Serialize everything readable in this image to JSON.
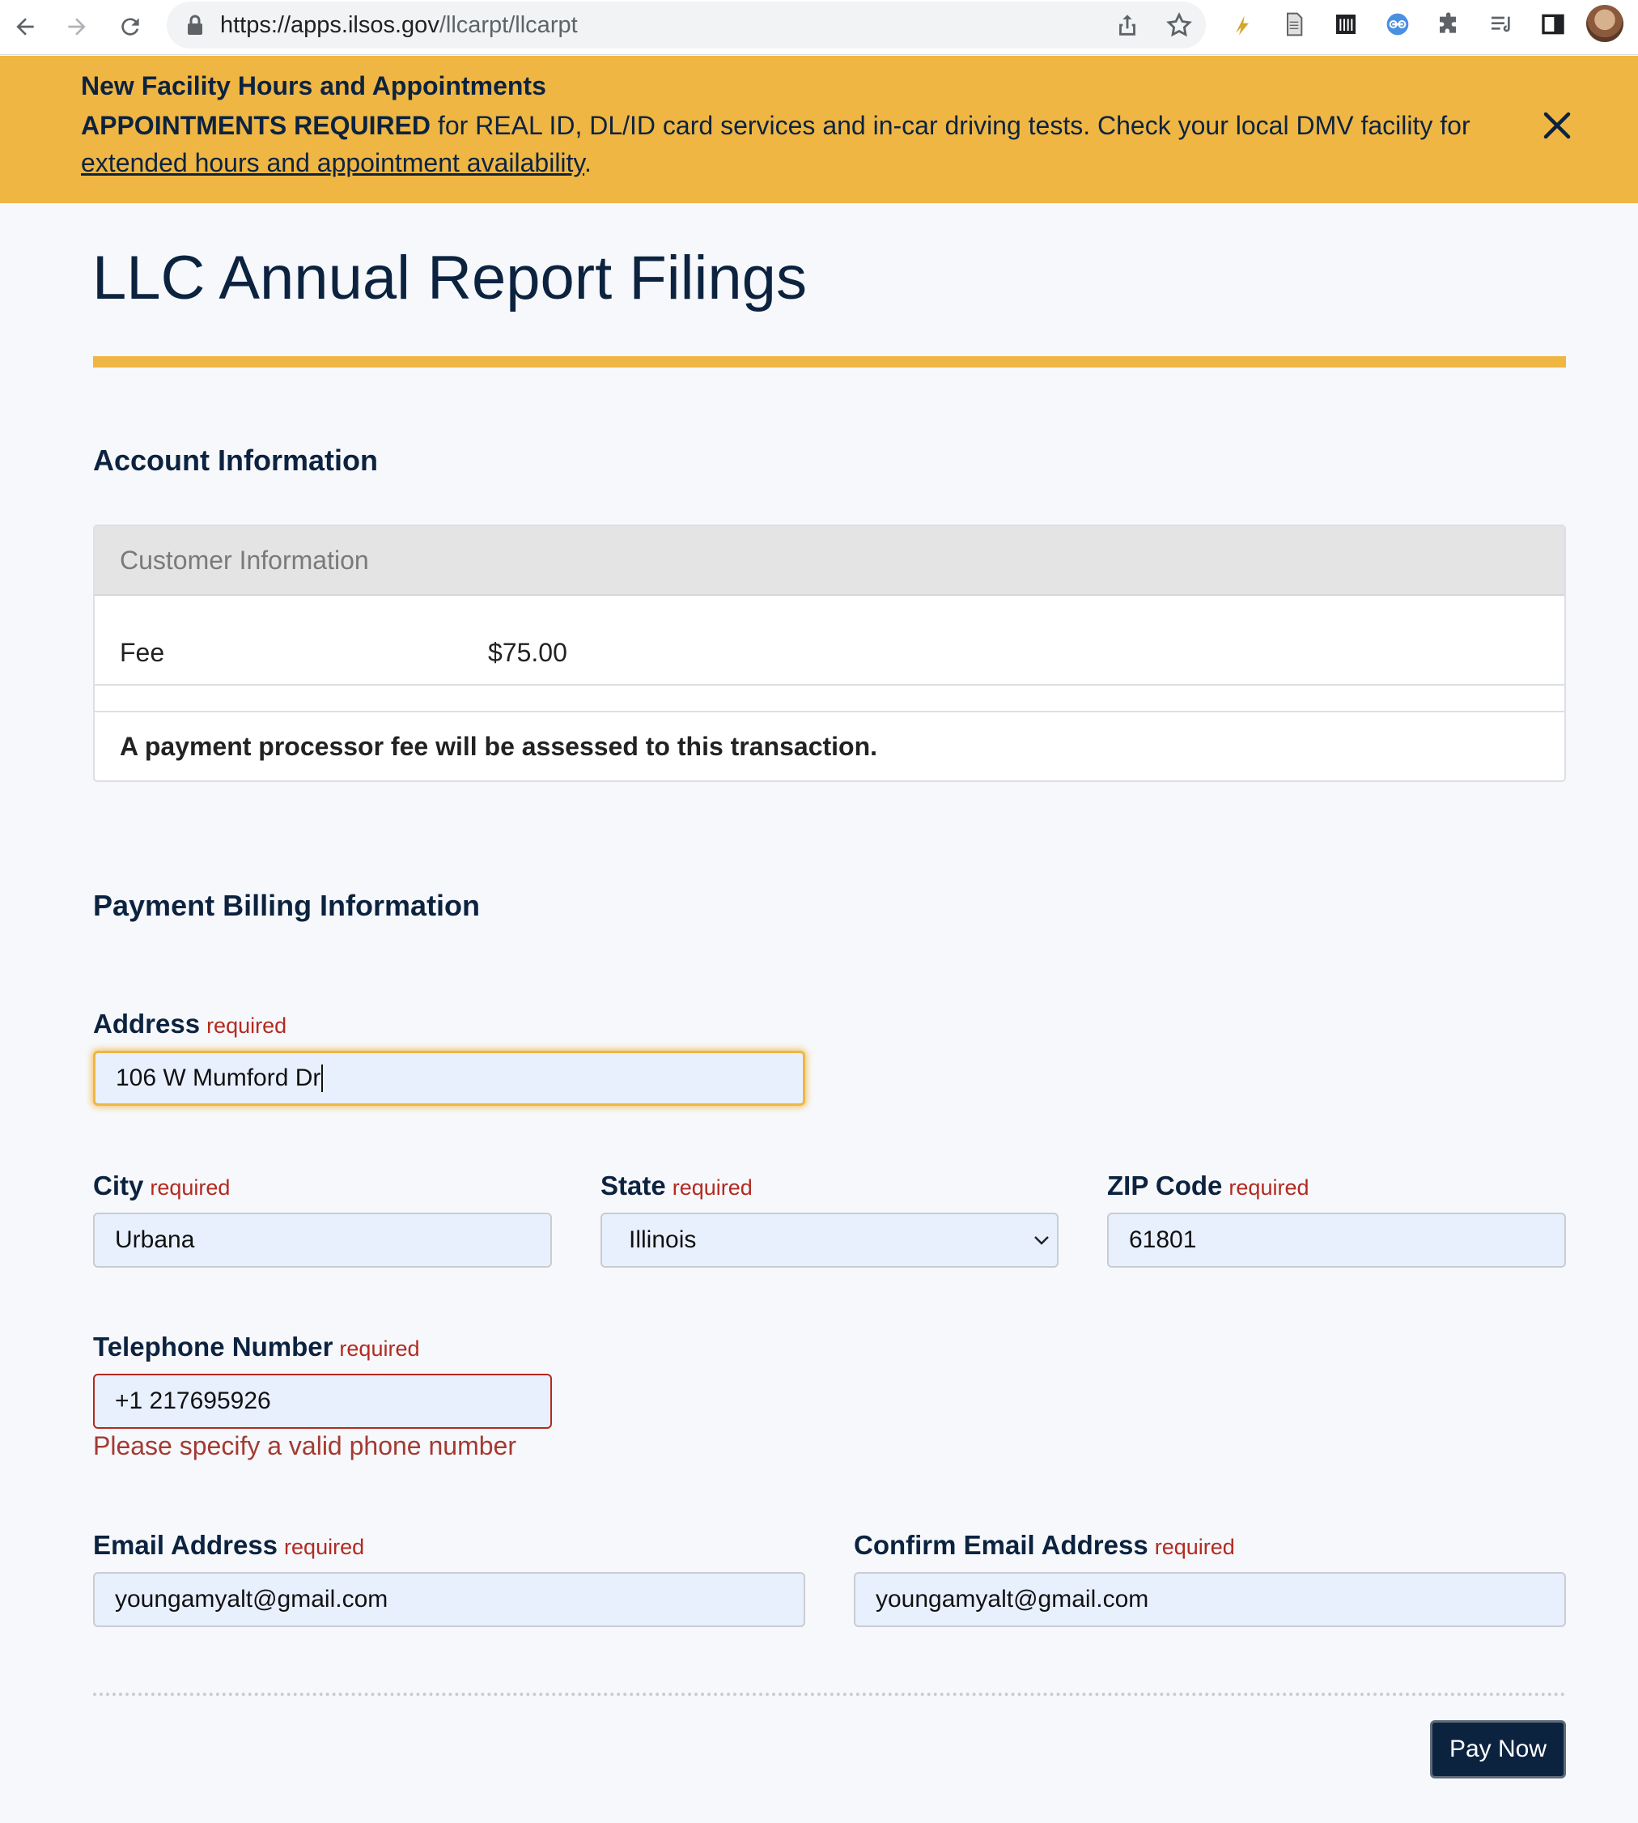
{
  "browser": {
    "url_host": "https://apps.ilsos.gov",
    "url_path": "/llcarpt/llcarpt",
    "icons": [
      "back-arrow-icon",
      "forward-arrow-icon",
      "reload-icon",
      "lock-icon",
      "share-icon",
      "star-icon",
      "extension-icons",
      "puzzle-icon",
      "reading-list-icon",
      "side-panel-icon",
      "profile-avatar"
    ]
  },
  "banner": {
    "title": "New Facility Hours and Appointments",
    "bold_text": "APPOINTMENTS REQUIRED",
    "text": " for REAL ID, DL/ID card services and in-car driving tests. Check your local DMV facility for ",
    "link_text": "extended hours and appointment availability",
    "end_text": ".",
    "background": "#efb643"
  },
  "page": {
    "title": "LLC Annual Report Filings"
  },
  "account": {
    "heading": "Account Information",
    "card_header": "Customer Information",
    "fee_label": "Fee",
    "fee_value": "$75.00",
    "note": "A payment processor fee will be assessed to this transaction."
  },
  "billing": {
    "heading": "Payment Billing Information",
    "required_text": "required",
    "address_label": "Address",
    "address_value": "106 W Mumford Dr",
    "city_label": "City",
    "city_value": "Urbana",
    "state_label": "State",
    "state_value": "Illinois",
    "zip_label": "ZIP Code",
    "zip_value": "61801",
    "phone_label": "Telephone Number",
    "phone_value": "+1 217695926",
    "phone_error": "Please specify a valid phone number",
    "email_label": "Email Address",
    "email_value": "youngamyalt@gmail.com",
    "confirm_email_label": "Confirm Email Address",
    "confirm_email_value": "youngamyalt@gmail.com"
  },
  "actions": {
    "pay_label": "Pay Now"
  },
  "colors": {
    "navy": "#0c2340",
    "gold": "#efb643",
    "error_red": "#b22a20",
    "input_fill": "#e8f0fe"
  }
}
